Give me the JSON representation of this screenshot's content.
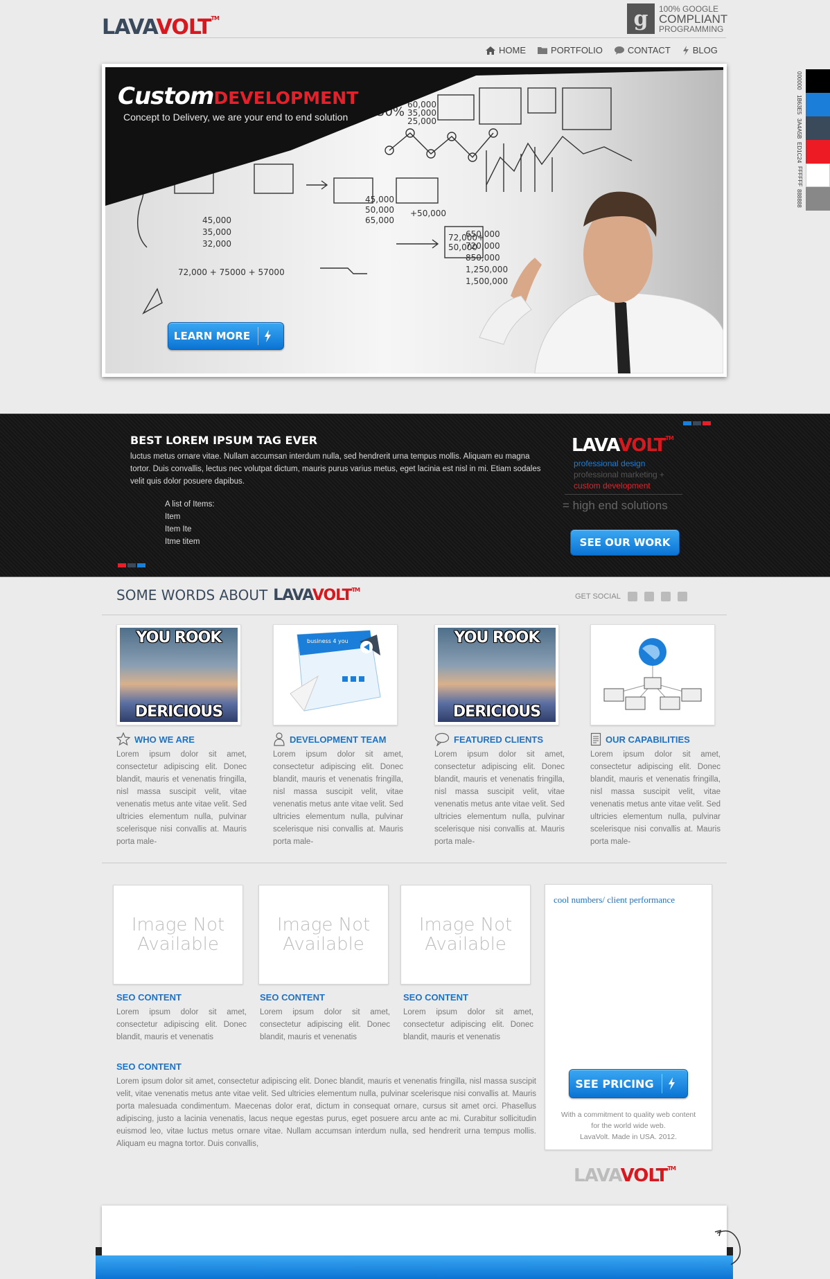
{
  "header": {
    "logo_lava": "LAVA",
    "logo_volt": "VOLT",
    "logo_tm": "TM",
    "badge": {
      "icon": "g",
      "line1": "100% GOOGLE",
      "line2": "COMPLIANT",
      "line3": "PROGRAMMING"
    }
  },
  "nav": [
    {
      "label": "HOME",
      "icon": "home-icon"
    },
    {
      "label": "PORTFOLIO",
      "icon": "folder-icon"
    },
    {
      "label": "CONTACT",
      "icon": "speech-bubble-icon"
    },
    {
      "label": "BLOG",
      "icon": "bolt-icon"
    }
  ],
  "swatches": [
    {
      "label": "000000",
      "color": "#000000"
    },
    {
      "label": "1B63E5",
      "color": "#1b7fd9"
    },
    {
      "label": "3A4A5B",
      "color": "#3a4a5b"
    },
    {
      "label": "ED1C24",
      "color": "#ed1c24"
    },
    {
      "label": "FFFFFF",
      "color": "#ffffff"
    },
    {
      "label": "888888",
      "color": "#888888"
    }
  ],
  "hero": {
    "title_a": "Custom",
    "title_b": "DEVELOPMENT",
    "subtitle": "Concept to Delivery, we are your end to end solution",
    "cta": "LEARN MORE",
    "board_numbers": [
      "45,000",
      "35,000",
      "32,000",
      "72,000 + 75000 + 57000",
      "650,000",
      "720,000",
      "850,000",
      "1,250,000",
      "1,500,000",
      "50%",
      "60,000",
      "35,000",
      "25,000",
      "45,000",
      "50,000",
      "65,000",
      "+50,000",
      "72,000+",
      "50,000"
    ]
  },
  "band": {
    "heading": "BEST LOREM IPSUM TAG EVER",
    "text": "luctus metus ornare vitae. Nullam accumsan interdum nulla, sed hendrerit urna tempus mollis. Aliquam eu magna tortor. Duis convallis, lectus nec volutpat dictum, mauris purus varius metus, eget lacinia est nisl in mi. Etiam sodales velit quis dolor posuere dapibus.",
    "list_title": "A list of Items:",
    "list_items": [
      "Item",
      "Item Ite",
      "Itme titem"
    ],
    "tag1": "professional design",
    "tag2": "professional marketing +",
    "tag3": "custom development",
    "tag4": "= high end solutions",
    "cta": "SEE OUR WORK",
    "colors": {
      "blue": "#1b7fd9",
      "red": "#e6202a",
      "gray": "#3a4a5b"
    }
  },
  "about": {
    "title": "SOME WORDS ABOUT",
    "get_social": "GET SOCIAL",
    "social_icons": [
      "twitter-icon",
      "facebook-icon",
      "flickr-icon",
      "youtube-icon"
    ],
    "cards": [
      {
        "title": "WHO WE ARE",
        "icon": "star-icon",
        "image": "meme",
        "meme_top": "YOU ROOK",
        "meme_bottom": "DERICIOUS",
        "body": "Lorem ipsum dolor sit amet, consectetur adipiscing elit. Donec blandit, mauris et venenatis fringilla, nisl massa suscipit velit, vitae venenatis metus ante vitae velit. Sed ultricies elementum nulla, pulvinar scelerisque nisi convallis at. Mauris porta male-"
      },
      {
        "title": "DEVELOPMENT TEAM",
        "icon": "person-icon",
        "image": "brochure",
        "brochure_text": "business 4 you",
        "body": "Lorem ipsum dolor sit amet, consectetur adipiscing elit. Donec blandit, mauris et venenatis fringilla, nisl massa suscipit velit, vitae venenatis metus ante vitae velit. Sed ultricies elementum nulla, pulvinar scelerisque nisi convallis at. Mauris porta male-"
      },
      {
        "title": "FEATURED CLIENTS",
        "icon": "speech-bubble-icon",
        "image": "meme",
        "meme_top": "YOU ROOK",
        "meme_bottom": "DERICIOUS",
        "body": "Lorem ipsum dolor sit amet, consectetur adipiscing elit. Donec blandit, mauris et venenatis fringilla, nisl massa suscipit velit, vitae venenatis metus ante vitae velit. Sed ultricies elementum nulla, pulvinar scelerisque nisi convallis at. Mauris porta male-"
      },
      {
        "title": "OUR CAPABILITIES",
        "icon": "document-icon",
        "image": "network",
        "body": "Lorem ipsum dolor sit amet, consectetur adipiscing elit. Donec blandit, mauris et venenatis fringilla, nisl massa suscipit velit, vitae venenatis metus ante vitae velit. Sed ultricies elementum nulla, pulvinar scelerisque nisi convallis at. Mauris porta male-"
      }
    ]
  },
  "seo": {
    "na_line1": "Image Not",
    "na_line2": "Available",
    "items": [
      {
        "title": "SEO CONTENT",
        "body": "Lorem ipsum dolor sit amet, consectetur adipiscing elit. Donec blandit, mauris et venenatis"
      },
      {
        "title": "SEO CONTENT",
        "body": "Lorem ipsum dolor sit amet, consectetur adipiscing elit. Donec blandit, mauris et venenatis"
      },
      {
        "title": "SEO CONTENT",
        "body": "Lorem ipsum dolor sit amet, consectetur adipiscing elit. Donec blandit, mauris et venenatis"
      }
    ],
    "long_title": "SEO CONTENT",
    "long_body": "Lorem ipsum dolor sit amet, consectetur adipiscing elit. Donec blandit, mauris et venenatis fringilla, nisl massa suscipit velit, vitae venenatis metus ante vitae velit. Sed ultricies elementum nulla, pulvinar scelerisque nisi convallis at. Mauris porta malesuada condimentum. Maecenas dolor erat, dictum in consequat ornare, cursus sit amet orci. Phasellus adipiscing, justo a lacinia venenatis, lacus neque egestas purus, eget posuere arcu ante ac mi. Curabitur sollicitudin euismod leo, vitae luctus metus ornare vitae. Nullam accumsan interdum nulla, sed hendrerit urna tempus mollis. Aliquam eu magna tortor. Duis convallis,"
  },
  "panel": {
    "title": "cool numbers/ client performance",
    "cta": "SEE PRICING",
    "foot1": "With a commitment to quality web content",
    "foot2": "for the world wide web.",
    "foot3": "LavaVolt. Made in USA. 2012."
  }
}
